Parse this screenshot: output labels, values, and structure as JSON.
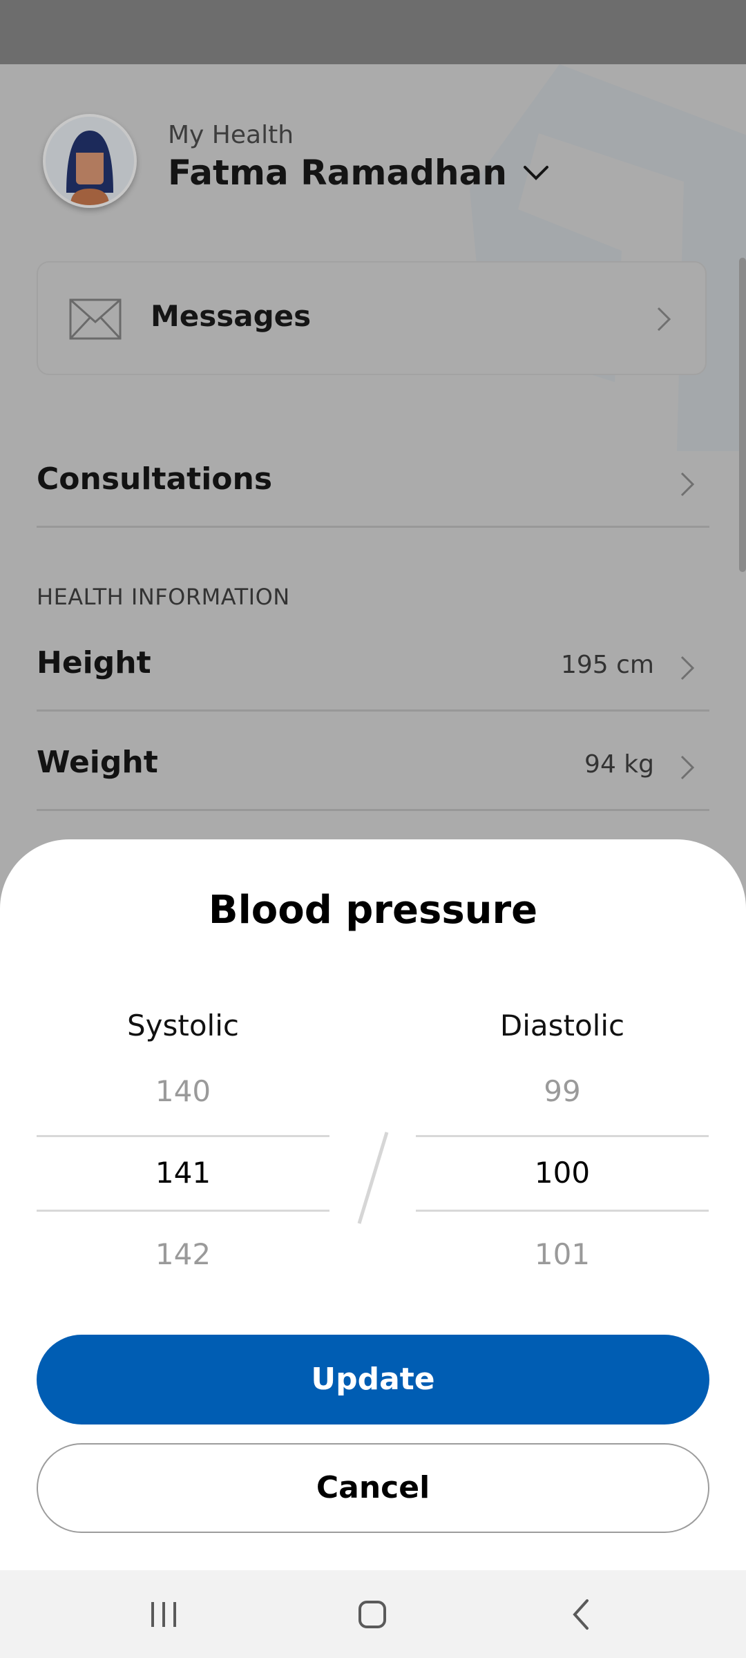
{
  "header": {
    "subtitle": "My Health",
    "name": "Fatma  Ramadhan"
  },
  "messages": {
    "label": "Messages"
  },
  "consultations": {
    "label": "Consultations"
  },
  "health_information": {
    "section_title": "HEALTH INFORMATION",
    "height": {
      "label": "Height",
      "value": "195 cm"
    },
    "weight": {
      "label": "Weight",
      "value": "94 kg"
    }
  },
  "sheet": {
    "title": "Blood pressure",
    "systolic": {
      "label": "Systolic",
      "above": "140",
      "selected": "141",
      "below": "142"
    },
    "diastolic": {
      "label": "Diastolic",
      "above": "99",
      "selected": "100",
      "below": "101"
    },
    "update_label": "Update",
    "cancel_label": "Cancel"
  },
  "colors": {
    "primary": "#005db3",
    "scrim": "#ababab"
  }
}
